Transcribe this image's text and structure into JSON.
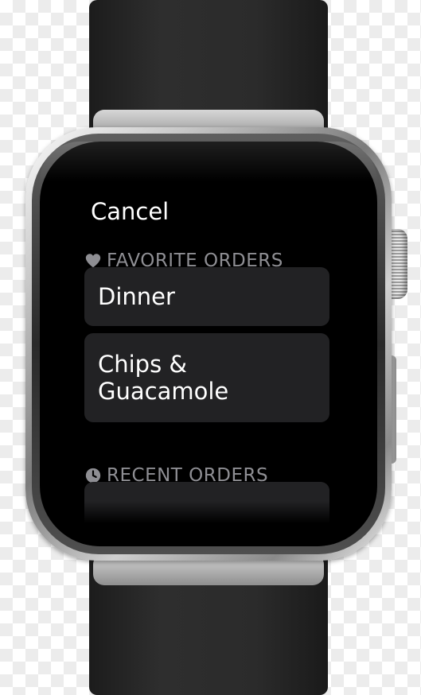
{
  "screen": {
    "cancel_label": "Cancel",
    "favorite_section": {
      "icon": "heart-icon",
      "label": "FAVORITE ORDERS"
    },
    "favorites": [
      {
        "label": "Dinner"
      },
      {
        "label": "Chips &\nGuacamole"
      }
    ],
    "recent_section": {
      "icon": "clock-icon",
      "label": "RECENT ORDERS"
    }
  },
  "colors": {
    "screen_background": "#000000",
    "row_background": "#222224",
    "section_text": "#8e8e93",
    "primary_text": "#ffffff"
  }
}
